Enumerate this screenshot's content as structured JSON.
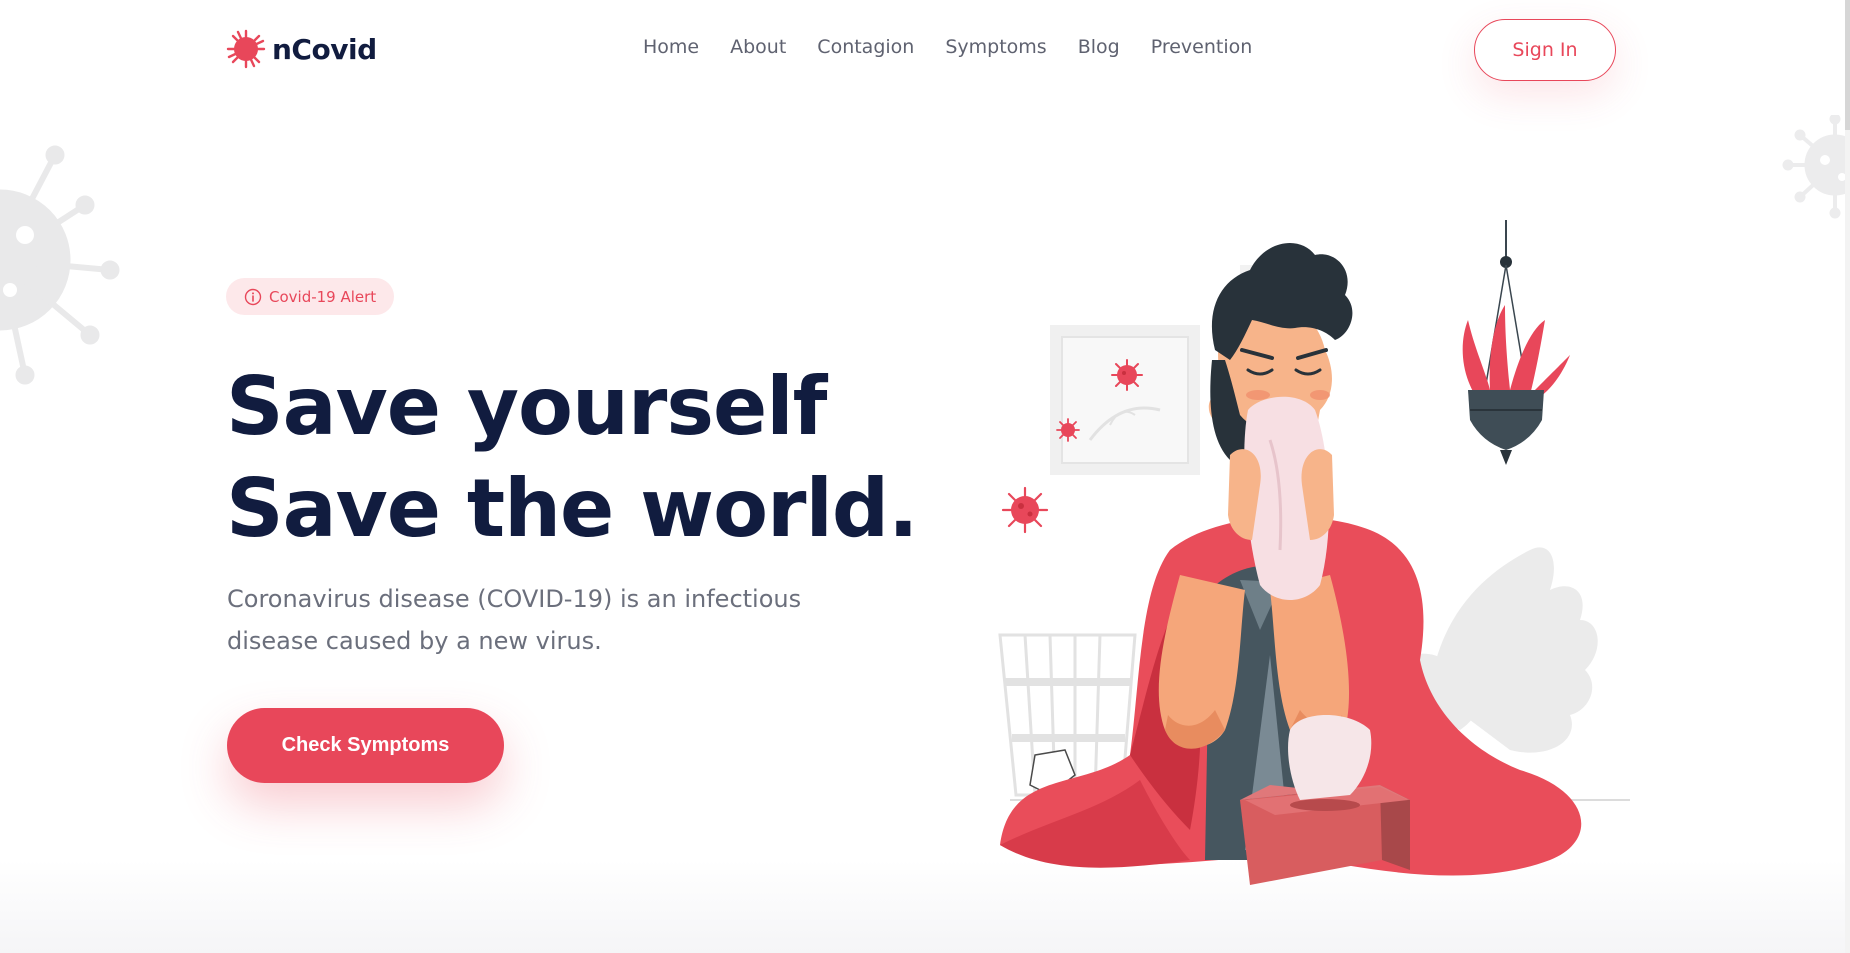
{
  "brand": {
    "name": "nCovid",
    "accent": "#e8475a",
    "dark": "#111c3f"
  },
  "nav": {
    "items": [
      {
        "label": "Home"
      },
      {
        "label": "About"
      },
      {
        "label": "Contagion"
      },
      {
        "label": "Symptoms"
      },
      {
        "label": "Blog"
      },
      {
        "label": "Prevention"
      }
    ],
    "signin_label": "Sign In"
  },
  "hero": {
    "badge": "Covid-19 Alert",
    "title_line1": "Save yourself",
    "title_line2": "Save the world.",
    "description": "Coronavirus disease (COVID-19) is an infectious disease caused by a new virus.",
    "cta_label": "Check Symptoms"
  },
  "icons": {
    "logo": "virus-icon",
    "badge": "info-icon"
  }
}
